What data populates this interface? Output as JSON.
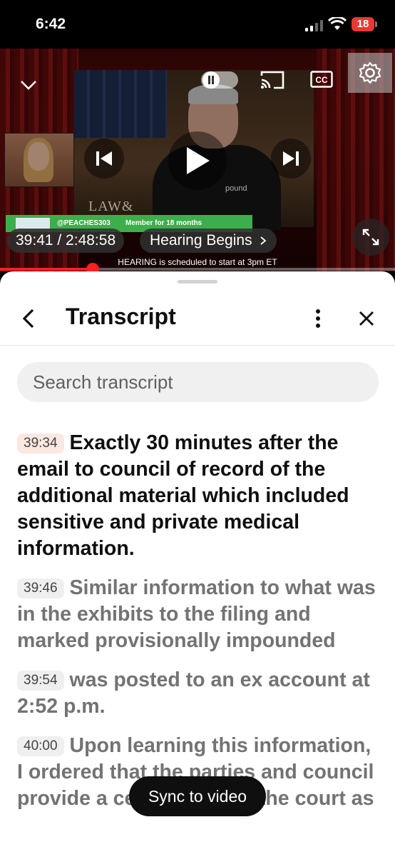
{
  "status_bar": {
    "time": "6:42",
    "battery": "18"
  },
  "player": {
    "lower_third_logo": "LAW&",
    "nameplate": "pound",
    "member_banner": {
      "handle": "@PEACHES303",
      "membership": "Member for 18 months"
    },
    "time_display": "39:41 / 2:48:58",
    "chapter": "Hearing Begins",
    "ticker": "HEARING is scheduled to start at 3pm ET",
    "progress": 0.235
  },
  "transcript": {
    "title": "Transcript",
    "search_placeholder": "Search transcript",
    "segments": [
      {
        "time": "39:34",
        "text": "Exactly 30 minutes after the email to council of record of the additional material which included sensitive and private medical information.",
        "active": true
      },
      {
        "time": "39:46",
        "text": "Similar information to what was in the exhibits to the filing and marked provisionally impounded",
        "active": false
      },
      {
        "time": "39:54",
        "text": "was posted to an ex account at 2:52 p.m.",
        "active": false
      },
      {
        "time": "40:00",
        "text": "Upon learning this information, I ordered that the parties and council provide a certification to the court as",
        "active": false
      }
    ],
    "sync_button": "Sync to video"
  }
}
